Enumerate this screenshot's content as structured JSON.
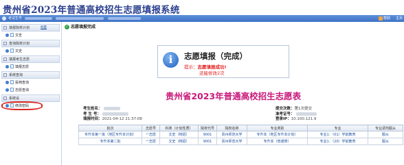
{
  "header": {
    "title": "贵州省2023年普通高校招生志愿填报系统"
  },
  "infobar": {
    "text": "考试生号",
    "help_label": "帮助",
    "home_label": "主页"
  },
  "sidebar": {
    "sections": [
      {
        "label": "填报院校计划",
        "toggle": "-",
        "extra": "批量",
        "items": [
          {
            "label": "文史"
          }
        ]
      },
      {
        "label": "查询院校计划",
        "toggle": "-",
        "items": [
          {
            "label": "文史"
          }
        ]
      },
      {
        "label": "填报考生志愿",
        "toggle": "-",
        "items": [
          {
            "label": "填报志愿"
          }
        ]
      },
      {
        "label": "系统查询",
        "toggle": "-",
        "items": [
          {
            "label": "投档查询"
          },
          {
            "label": "志愿查询"
          }
        ]
      },
      {
        "label": "系统设",
        "toggle": "-",
        "items": [
          {
            "label": "修改密码"
          }
        ]
      }
    ],
    "highlighted_item": "志愿查询",
    "highlight_color": "#d9231f"
  },
  "main": {
    "breadcrumb": "志愿填报完成",
    "message": {
      "title": "志愿填报（完成）",
      "line1_prefix": "提示：",
      "line1": "志愿填报成功!",
      "line2": "还能修改2次",
      "color": "#e02020"
    },
    "form_title": "贵州省2023年普通高校招生志愿表",
    "form_title_color": "#c8187a",
    "candidate_info": {
      "left": [
        {
          "label": "考生姓名：",
          "value": ""
        },
        {
          "label": "考 生 号：",
          "value": ""
        },
        {
          "label": "填报时间：",
          "value": "2021-04-12 21:37:08"
        }
      ],
      "right": [
        {
          "label": "提交次数：",
          "value": "第1次提交"
        },
        {
          "label": "准考证号：",
          "value": ""
        },
        {
          "label": "登录IP：",
          "value": "10.100.121.9"
        }
      ]
    },
    "table": {
      "columns": [
        "批次",
        "志愿号",
        "科类（计划性质）",
        "院校代号",
        "院校名称",
        "专业类别",
        "专业",
        "专业调剂服从"
      ],
      "rows": [
        [
          "专升本第一批（地区专升本计划）",
          "一志愿",
          "文史（统招）",
          "9001",
          "贵州师范大学",
          "专升本（地区专升本计划）",
          "专业1：（01）学前教育",
          "服从"
        ],
        [
          "专升本第二批",
          "一志愿",
          "文史（统招）",
          "9001",
          "贵州师范大学",
          "专升本（普通类）",
          "专业1：（20）学前教育",
          "服从"
        ]
      ]
    }
  }
}
